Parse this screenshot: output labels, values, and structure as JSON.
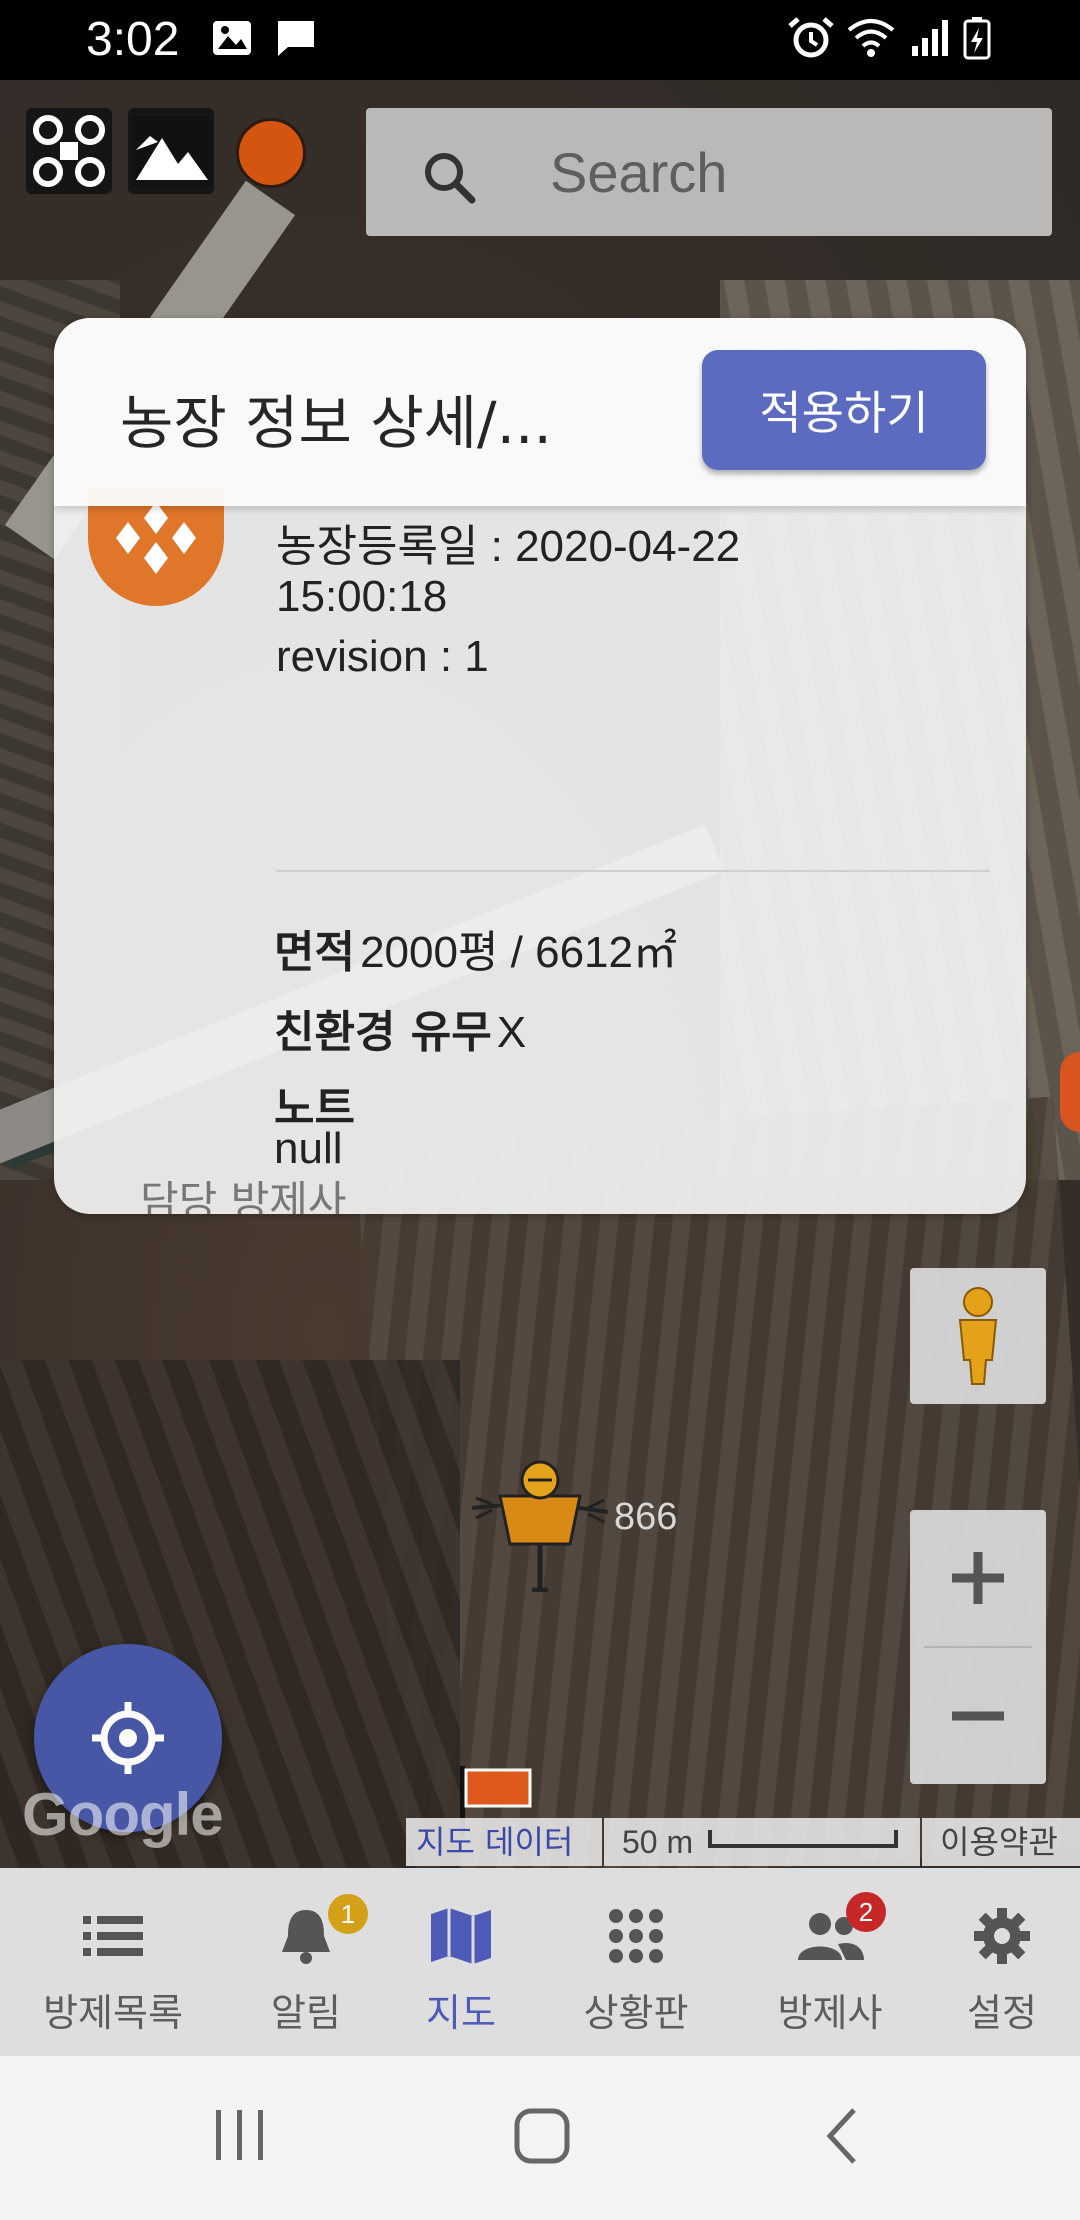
{
  "status_bar": {
    "time": "3:02"
  },
  "search": {
    "placeholder": "Search"
  },
  "dialog": {
    "title": "농장 정보 상세/...",
    "apply_label": "적용하기",
    "registered_label": "농장등록일 : 2020-04-22",
    "registered_time": "15:00:18",
    "revision": "revision : 1",
    "area_label": "면적",
    "area_value": "2000평 / 6612㎡",
    "eco_label": "친환경 유무",
    "eco_value": "X",
    "note_label": "노트",
    "note_value": "null",
    "manager_label": "담당 방제사"
  },
  "map": {
    "marker_label": "866",
    "attribution_data": "지도 데이터",
    "scale_label": "50 m",
    "terms_label": "이용약관",
    "google_logo": "Google"
  },
  "bottom_nav": {
    "items": [
      {
        "label": "방제목록",
        "icon": "list-icon"
      },
      {
        "label": "알림",
        "icon": "bell-icon",
        "badge": "1",
        "badge_color": "#d4a017"
      },
      {
        "label": "지도",
        "icon": "map-icon",
        "active": true
      },
      {
        "label": "상황판",
        "icon": "grid-icon"
      },
      {
        "label": "방제사",
        "icon": "people-icon",
        "badge": "2",
        "badge_color": "#c62828"
      },
      {
        "label": "설정",
        "icon": "gear-icon"
      }
    ]
  },
  "colors": {
    "accent": "#5c6bc0",
    "fab": "#4757a6",
    "record": "#d4550f"
  }
}
